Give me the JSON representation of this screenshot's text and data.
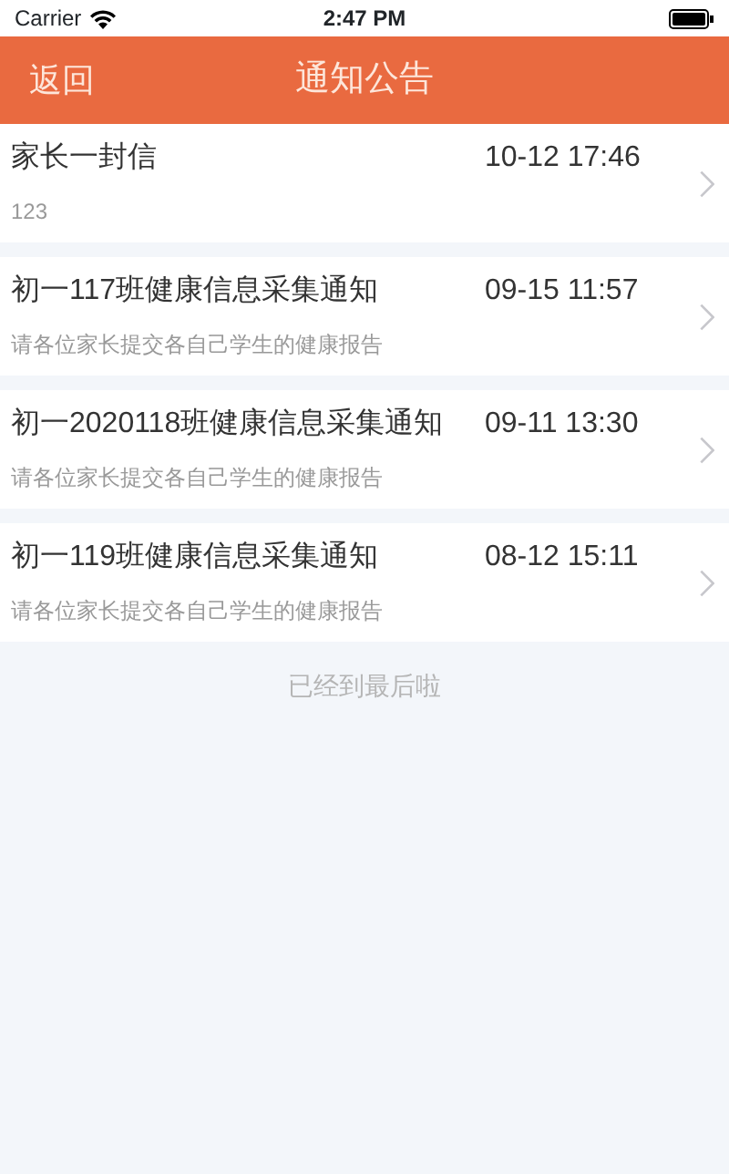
{
  "status_bar": {
    "carrier": "Carrier",
    "time": "2:47 PM"
  },
  "nav_bar": {
    "back": "返回",
    "title": "通知公告"
  },
  "notices": [
    {
      "title": "家长一封信",
      "date": "10-12 17:46",
      "summary": "123"
    },
    {
      "title": "初一117班健康信息采集通知",
      "date": "09-15 11:57",
      "summary": "请各位家长提交各自己学生的健康报告"
    },
    {
      "title": "初一2020118班健康信息采集通知",
      "date": "09-11 13:30",
      "summary": "请各位家长提交各自己学生的健康报告"
    },
    {
      "title": "初一119班健康信息采集通知",
      "date": "08-12 15:11",
      "summary": "请各位家长提交各自己学生的健康报告"
    }
  ],
  "end_note": "已经到最后啦"
}
